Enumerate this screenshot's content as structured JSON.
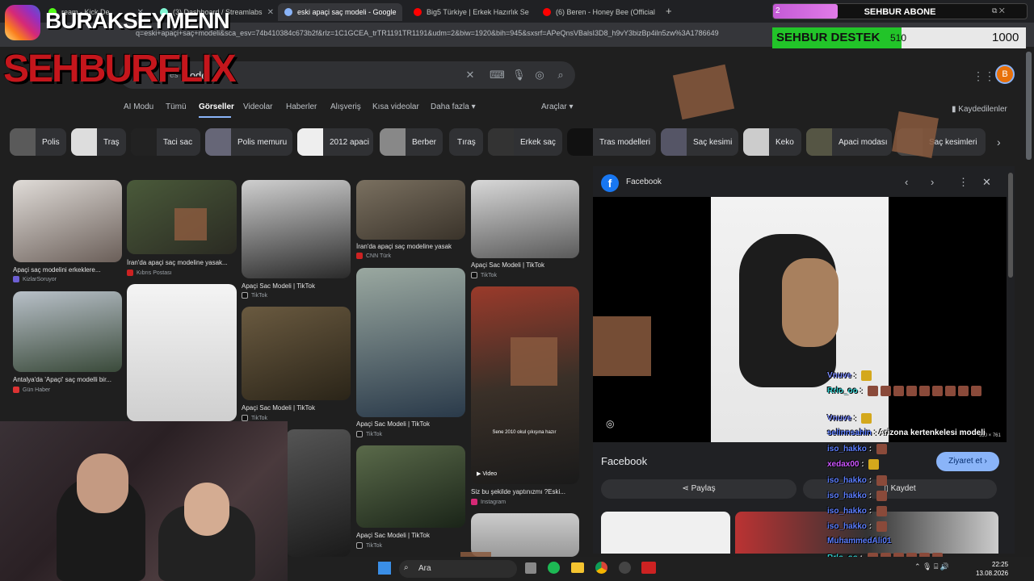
{
  "tabs": [
    {
      "label": "ream - Kick De",
      "color": "#53fc18"
    },
    {
      "label": "(3) Dashboard / Streamlabs",
      "color": "#80f5d2"
    },
    {
      "label": "eski apaçi saç modeli - Google",
      "color": "#8ab4f8"
    },
    {
      "label": "Big5 Türkiye | Erkek Hazırlık Se",
      "color": "#ff0000"
    },
    {
      "label": "(6) Beren - Honey Bee (Official",
      "color": "#ff0000"
    }
  ],
  "url": "q=eski+apaçi+saç+modeli&sca_esv=74b410384c673b2f&rlz=1C1GCEA_trTR1191TR1191&udm=2&biw=1920&bih=945&sxsrf=APeQnsVBalsI3D8_h9vY3bizBp4iln5zw%3A1786649",
  "search": {
    "query": "modeli",
    "prefix": "es"
  },
  "nav": {
    "items": [
      "AI Modu",
      "Tümü",
      "Görseller",
      "Videolar",
      "Haberler",
      "Alışveriş",
      "Kısa videolar",
      "Daha fazla ▾"
    ],
    "tools": "Araçlar ▾",
    "saved": "Kaydedilenler"
  },
  "chips": [
    "Polis",
    "Traş",
    "Taci sac",
    "Polis memuru",
    "2012 apaci",
    "Berber",
    "Tıraş",
    "Erkek saç",
    "Tras modelleri",
    "Saç kesimi",
    "Keko",
    "Apaci modası",
    "Saç kesimleri"
  ],
  "results": [
    {
      "cap": "Apaçi saç modelini erkeklere...",
      "src": "KizlarSoruyor"
    },
    {
      "cap": "İran'da apaçi saç modeline yasak...",
      "src": "Kıbrıs Postası"
    },
    {
      "cap": "Apaçi Sac Modeli | TikTok",
      "src": "TikTok"
    },
    {
      "cap": "İran'da apaçi saç modeline yasak",
      "src": "CNN Türk"
    },
    {
      "cap": "Apaçi Sac Modeli | TikTok",
      "src": "TikTok"
    },
    {
      "cap": "Antalya'da 'Apaçi' saç modelli bir...",
      "src": "Gün Haber"
    },
    {
      "cap": "Apaçi Sac Modeli | TikTok",
      "src": "TikTok"
    },
    {
      "cap": "Apaçi Sac Modeli | TikTok",
      "src": "TikTok"
    },
    {
      "cap": "Siz bu şekilde yaptınızmı ?Eski...",
      "src": "Instagram"
    },
    {
      "cap": "Apaçi Sac Modeli | TikTok",
      "src": "TikTok"
    }
  ],
  "video_badge": "Video",
  "overlay_text": "Sene 2010 okul çıkışına hazır",
  "panel": {
    "source_top": "Facebook",
    "source": "Facebook",
    "visit": "Ziyaret et ›",
    "share": "Paylaş",
    "save": "Kaydet",
    "dims": "550 × 761"
  },
  "taskbar": {
    "search": "Ara",
    "time": "22:25",
    "date": "13.08.2026"
  },
  "overlay": {
    "ig_name": "BURAKSEYMENN",
    "brand": "SEHBURFLIX",
    "abone_count": "2",
    "abone_label": "SEHBUR ABONE",
    "destek_label": "SEHBUR DESTEK",
    "destek_current": "510",
    "destek_goal": "1000",
    "destek_fraction": 0.51
  },
  "chat": [
    {
      "user": "Vnuve",
      "text": "",
      "color": "#7b8cff"
    },
    {
      "user": "Rrlo_oo",
      "text": "",
      "color": "#3cc"
    },
    {
      "user": "Vnuve",
      "text": "",
      "color": "#7b8cff"
    },
    {
      "user": "selinnsahin",
      "text": "Arizona kertenkelesi modeli",
      "color": "#5b7dff"
    },
    {
      "user": "iso_hakko",
      "text": "",
      "color": "#5b7dff"
    },
    {
      "user": "xedax00",
      "text": "",
      "color": "#c5f"
    },
    {
      "user": "iso_hakko",
      "text": "",
      "color": "#5b7dff"
    },
    {
      "user": "iso_hakko",
      "text": "",
      "color": "#5b7dff"
    },
    {
      "user": "iso_hakko",
      "text": "",
      "color": "#5b7dff"
    },
    {
      "user": "iso_hakko",
      "text": "",
      "color": "#5b7dff"
    },
    {
      "user": "MuhammedAli01",
      "text": "",
      "color": "#5b7dff"
    },
    {
      "user": "Rrlo_oo",
      "text": "",
      "color": "#3cc"
    }
  ]
}
